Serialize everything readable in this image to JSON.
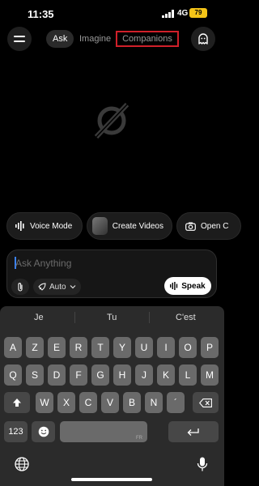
{
  "status_bar": {
    "time": "11:35",
    "network": "4G",
    "battery": "79"
  },
  "header": {
    "tabs": [
      {
        "label": "Ask",
        "active": true
      },
      {
        "label": "Imagine",
        "active": false
      },
      {
        "label": "Companions",
        "active": false,
        "highlighted": true
      }
    ]
  },
  "chips": {
    "voice": "Voice Mode",
    "create": "Create Videos",
    "open": "Open C"
  },
  "input": {
    "placeholder": "Ask Anything",
    "mode": "Auto",
    "speak": "Speak"
  },
  "keyboard": {
    "suggestions": [
      "Je",
      "Tu",
      "C'est"
    ],
    "row1": [
      "A",
      "Z",
      "E",
      "R",
      "T",
      "Y",
      "U",
      "I",
      "O",
      "P"
    ],
    "row2": [
      "Q",
      "S",
      "D",
      "F",
      "G",
      "H",
      "J",
      "K",
      "L",
      "M"
    ],
    "row3": [
      "W",
      "X",
      "C",
      "V",
      "B",
      "N",
      "´"
    ],
    "numbers_label": "123",
    "space_label": "FR"
  },
  "colors": {
    "accent_highlight": "#d0202a",
    "battery": "#f5c518",
    "caret": "#3b82f6"
  },
  "icons": [
    "menu-icon",
    "ghost-icon",
    "grok-logo",
    "waveform-icon",
    "camera-icon",
    "paperclip-icon",
    "rocket-icon",
    "chevron-down-icon",
    "shift-icon",
    "backspace-icon",
    "emoji-icon",
    "return-icon",
    "globe-icon",
    "mic-icon"
  ]
}
